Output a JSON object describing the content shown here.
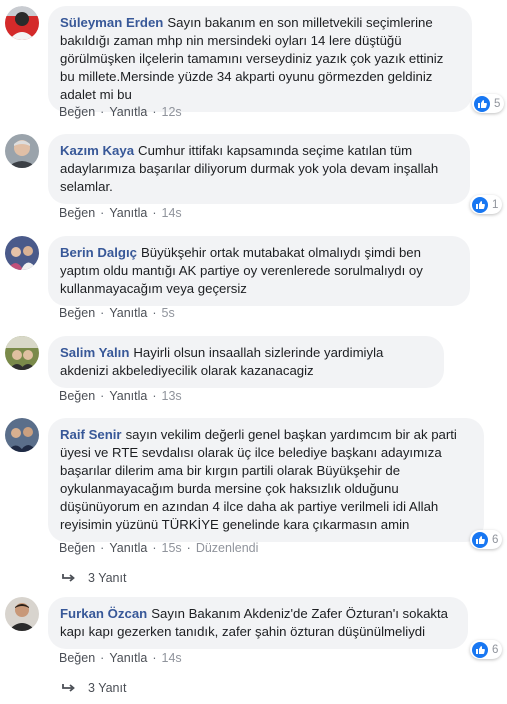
{
  "labels": {
    "like": "Beğen",
    "reply": "Yanıtla",
    "separator": "·"
  },
  "comments": [
    {
      "author": "Süleyman Erden",
      "text": "Sayın bakanım en son milletvekili seçimlerine bakıldığı zaman mhp nin mersindeki oyları 14 lere düştüğü görülmüşken ilçelerin tamamını verseydiniz yazık çok yazık ettiniz bu millete.Mersinde yüzde 34 akparti oyunu görmezden geldiniz adalet mi bu",
      "time": "12s",
      "reactions": "5"
    },
    {
      "author": "Kazım Kaya",
      "text": "Cumhur ittifakı kapsamında seçime katılan tüm adaylarımıza başarılar diliyorum durmak yok yola devam inşallah selamlar.",
      "time": "14s",
      "reactions": "1"
    },
    {
      "author": "Berin Dalgıç",
      "text": "Büyükşehir ortak mutabakat olmalıydı şimdi ben yaptım oldu mantığı AK partiye oy verenlerede sorulmalıydı oy kullanmayacağım veya geçersiz",
      "time": "5s"
    },
    {
      "author": "Salim Yalın",
      "text": "Hayirli olsun insaallah sizlerinde yardimiyla akdenizi akbelediyecilik olarak kazanacagiz",
      "time": "13s"
    },
    {
      "author": "Raif Senir",
      "text": "sayın vekilim değerli genel başkan yardımcım bir ak parti üyesi ve RTE sevdalısı olarak üç ilce belediye başkanı adayımıza başarılar dilerim ama bir kırgın partili olarak Büyükşehir de oykulanmayacağım burda mersine çok haksızlık olduğunu düşünüyorum en azından 4 ilce daha ak partiye verilmeli idi Allah reyisimin yüzünü TÜRKİYE genelinde kara çıkarmasın amin",
      "time": "15s",
      "edited": "Düzenlendi",
      "reactions": "6",
      "replies": "3 Yanıt"
    },
    {
      "author": "Furkan Özcan",
      "text": "Sayın Bakanım Akdeniz'de Zafer Özturan'ı sokakta kapı kapı gezerken tanıdık, zafer şahin özturan düşünülmeliydi",
      "time": "14s",
      "reactions": "6",
      "replies": "3 Yanıt"
    }
  ],
  "colors": {
    "author": "#385898",
    "bubble": "#f2f3f5",
    "like": "#1877f2",
    "meta": "#90949c"
  }
}
